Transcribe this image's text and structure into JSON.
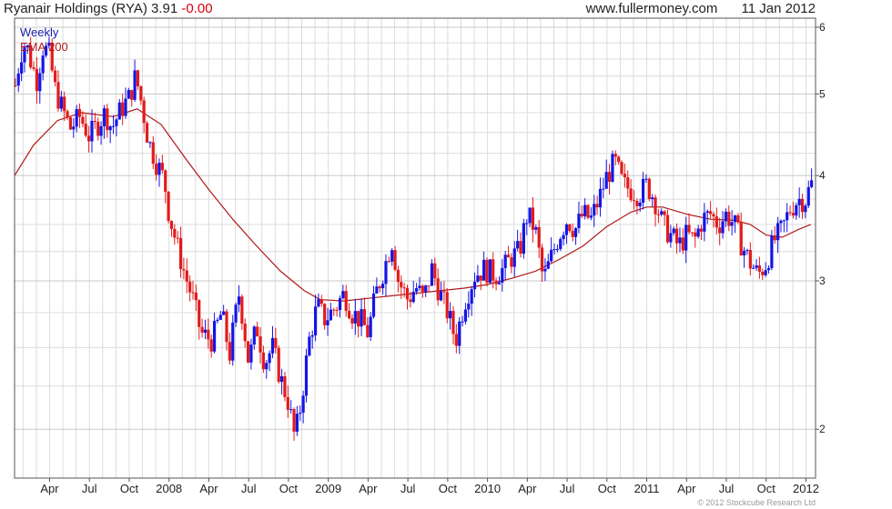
{
  "header": {
    "title": "Ryanair Holdings (RYA)",
    "price": "3.91",
    "change": "-0.00",
    "site": "www.fullermoney.com",
    "date": "11 Jan 2012"
  },
  "copyright": "© 2012 Stockcube Research Ltd",
  "colors": {
    "up": "#1515e6",
    "down": "#e21b1b",
    "ema": "#b01818",
    "grid": "#dcdcdc",
    "frame": "#555555"
  },
  "chart_data": {
    "type": "candlestick",
    "legend": [
      "Weekly",
      "EMA 200"
    ],
    "legend_colors": [
      "#1a1aa8",
      "#b01818"
    ],
    "y_scale": "log",
    "ylim": [
      1.75,
      6.15
    ],
    "yticks": [
      2,
      3,
      4,
      5,
      6
    ],
    "x_labels": [
      {
        "t": 2007.25,
        "label": "Apr"
      },
      {
        "t": 2007.5,
        "label": "Jul"
      },
      {
        "t": 2007.75,
        "label": "Oct"
      },
      {
        "t": 2008.0,
        "label": "2008"
      },
      {
        "t": 2008.25,
        "label": "Apr"
      },
      {
        "t": 2008.5,
        "label": "Jul"
      },
      {
        "t": 2008.75,
        "label": "Oct"
      },
      {
        "t": 2009.0,
        "label": "2009"
      },
      {
        "t": 2009.25,
        "label": "Apr"
      },
      {
        "t": 2009.5,
        "label": "Jul"
      },
      {
        "t": 2009.75,
        "label": "Oct"
      },
      {
        "t": 2010.0,
        "label": "2010"
      },
      {
        "t": 2010.25,
        "label": "Apr"
      },
      {
        "t": 2010.5,
        "label": "Jul"
      },
      {
        "t": 2010.75,
        "label": "Oct"
      },
      {
        "t": 2011.0,
        "label": "2011"
      },
      {
        "t": 2011.25,
        "label": "Apr"
      },
      {
        "t": 2011.5,
        "label": "Jul"
      },
      {
        "t": 2011.75,
        "label": "Oct"
      },
      {
        "t": 2012.0,
        "label": "2012"
      }
    ],
    "xlim": [
      2007.03,
      2012.06
    ],
    "price_path": [
      [
        2007.03,
        5.05
      ],
      [
        2007.07,
        5.6
      ],
      [
        2007.1,
        5.75
      ],
      [
        2007.14,
        5.4
      ],
      [
        2007.17,
        5.2
      ],
      [
        2007.21,
        5.7
      ],
      [
        2007.25,
        5.55
      ],
      [
        2007.28,
        5.1
      ],
      [
        2007.32,
        4.85
      ],
      [
        2007.38,
        4.55
      ],
      [
        2007.44,
        4.7
      ],
      [
        2007.5,
        4.45
      ],
      [
        2007.55,
        4.6
      ],
      [
        2007.6,
        4.75
      ],
      [
        2007.64,
        4.55
      ],
      [
        2007.7,
        4.8
      ],
      [
        2007.75,
        4.95
      ],
      [
        2007.79,
        5.25
      ],
      [
        2007.83,
        4.85
      ],
      [
        2007.87,
        4.4
      ],
      [
        2007.92,
        4.15
      ],
      [
        2007.97,
        3.95
      ],
      [
        2008.0,
        3.6
      ],
      [
        2008.05,
        3.3
      ],
      [
        2008.1,
        3.05
      ],
      [
        2008.15,
        2.85
      ],
      [
        2008.2,
        2.6
      ],
      [
        2008.27,
        2.55
      ],
      [
        2008.33,
        2.75
      ],
      [
        2008.38,
        2.45
      ],
      [
        2008.44,
        2.9
      ],
      [
        2008.5,
        2.4
      ],
      [
        2008.55,
        2.65
      ],
      [
        2008.6,
        2.4
      ],
      [
        2008.65,
        2.5
      ],
      [
        2008.7,
        2.3
      ],
      [
        2008.75,
        2.15
      ],
      [
        2008.79,
        1.95
      ],
      [
        2008.83,
        2.15
      ],
      [
        2008.88,
        2.55
      ],
      [
        2008.93,
        2.8
      ],
      [
        2008.98,
        2.7
      ],
      [
        2009.05,
        2.8
      ],
      [
        2009.1,
        2.9
      ],
      [
        2009.15,
        2.75
      ],
      [
        2009.2,
        2.7
      ],
      [
        2009.25,
        2.6
      ],
      [
        2009.3,
        2.9
      ],
      [
        2009.35,
        3.1
      ],
      [
        2009.4,
        3.35
      ],
      [
        2009.44,
        3.0
      ],
      [
        2009.5,
        2.85
      ],
      [
        2009.55,
        2.95
      ],
      [
        2009.6,
        2.85
      ],
      [
        2009.65,
        3.1
      ],
      [
        2009.7,
        2.9
      ],
      [
        2009.75,
        2.75
      ],
      [
        2009.8,
        2.55
      ],
      [
        2009.86,
        2.85
      ],
      [
        2009.92,
        3.05
      ],
      [
        2009.98,
        3.1
      ],
      [
        2010.05,
        3.05
      ],
      [
        2010.1,
        3.1
      ],
      [
        2010.15,
        3.2
      ],
      [
        2010.2,
        3.25
      ],
      [
        2010.25,
        3.6
      ],
      [
        2010.3,
        3.45
      ],
      [
        2010.35,
        3.0
      ],
      [
        2010.4,
        3.2
      ],
      [
        2010.45,
        3.4
      ],
      [
        2010.5,
        3.55
      ],
      [
        2010.55,
        3.45
      ],
      [
        2010.6,
        3.6
      ],
      [
        2010.65,
        3.55
      ],
      [
        2010.7,
        3.75
      ],
      [
        2010.75,
        4.0
      ],
      [
        2010.8,
        4.15
      ],
      [
        2010.85,
        3.9
      ],
      [
        2010.9,
        3.85
      ],
      [
        2010.95,
        3.8
      ],
      [
        2011.0,
        3.9
      ],
      [
        2011.05,
        3.75
      ],
      [
        2011.1,
        3.5
      ],
      [
        2011.15,
        3.4
      ],
      [
        2011.2,
        3.3
      ],
      [
        2011.25,
        3.4
      ],
      [
        2011.3,
        3.35
      ],
      [
        2011.35,
        3.55
      ],
      [
        2011.4,
        3.6
      ],
      [
        2011.45,
        3.5
      ],
      [
        2011.5,
        3.6
      ],
      [
        2011.55,
        3.5
      ],
      [
        2011.6,
        3.3
      ],
      [
        2011.65,
        3.15
      ],
      [
        2011.7,
        3.05
      ],
      [
        2011.75,
        3.15
      ],
      [
        2011.8,
        3.35
      ],
      [
        2011.85,
        3.45
      ],
      [
        2011.9,
        3.65
      ],
      [
        2011.95,
        3.75
      ],
      [
        2012.0,
        3.75
      ],
      [
        2012.03,
        3.91
      ]
    ],
    "ema_200": [
      [
        2007.03,
        4.0
      ],
      [
        2007.15,
        4.35
      ],
      [
        2007.3,
        4.65
      ],
      [
        2007.45,
        4.75
      ],
      [
        2007.65,
        4.7
      ],
      [
        2007.8,
        4.8
      ],
      [
        2007.95,
        4.6
      ],
      [
        2008.1,
        4.2
      ],
      [
        2008.25,
        3.85
      ],
      [
        2008.4,
        3.55
      ],
      [
        2008.55,
        3.3
      ],
      [
        2008.7,
        3.08
      ],
      [
        2008.85,
        2.92
      ],
      [
        2008.95,
        2.85
      ],
      [
        2009.1,
        2.84
      ],
      [
        2009.25,
        2.86
      ],
      [
        2009.4,
        2.88
      ],
      [
        2009.55,
        2.9
      ],
      [
        2009.7,
        2.92
      ],
      [
        2009.85,
        2.94
      ],
      [
        2010.0,
        2.97
      ],
      [
        2010.15,
        3.02
      ],
      [
        2010.3,
        3.08
      ],
      [
        2010.45,
        3.18
      ],
      [
        2010.6,
        3.3
      ],
      [
        2010.75,
        3.48
      ],
      [
        2010.9,
        3.62
      ],
      [
        2011.0,
        3.67
      ],
      [
        2011.1,
        3.67
      ],
      [
        2011.25,
        3.6
      ],
      [
        2011.4,
        3.55
      ],
      [
        2011.55,
        3.54
      ],
      [
        2011.65,
        3.5
      ],
      [
        2011.75,
        3.4
      ],
      [
        2011.85,
        3.38
      ],
      [
        2011.95,
        3.45
      ],
      [
        2012.03,
        3.5
      ]
    ]
  }
}
